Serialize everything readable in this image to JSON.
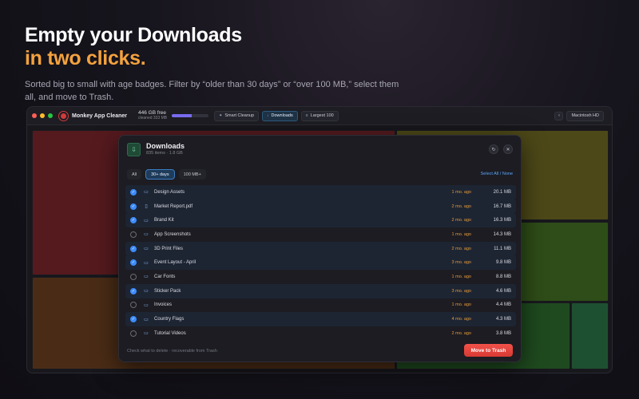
{
  "hero": {
    "title_line1": "Empty your Downloads",
    "title_line2": "in two clicks.",
    "subtitle": "Sorted big to small with age badges. Filter by “older than 30 days” or “over 100 MB,” select them all, and move to Trash."
  },
  "app": {
    "name": "Monkey App Cleaner",
    "disk_free": "446 GB free",
    "cleaned": "cleaned 333 MB",
    "disk_used_fraction": 0.55,
    "toolbar": [
      {
        "label": "Smart Cleanup",
        "icon": "sparkle-icon",
        "active": false
      },
      {
        "label": "Downloads",
        "icon": "download-icon",
        "active": true
      },
      {
        "label": "Largest 100",
        "icon": "list-icon",
        "active": false
      }
    ],
    "volume": "Macintosh HD"
  },
  "dialog": {
    "title": "Downloads",
    "meta": "835 items · 1.8 GB",
    "filters": [
      {
        "label": "All",
        "active": false
      },
      {
        "label": "30+ days",
        "active": true
      },
      {
        "label": "100 MB+",
        "active": false
      }
    ],
    "select_all": "Select All / None",
    "rows": [
      {
        "name": "Design Assets",
        "type": "folder",
        "age": "1 mo. ago",
        "size": "20.1 MB",
        "checked": true
      },
      {
        "name": "Market Report.pdf",
        "type": "file",
        "age": "2 mo. ago",
        "size": "16.7 MB",
        "checked": true
      },
      {
        "name": "Brand Kit",
        "type": "folder",
        "age": "2 mo. ago",
        "size": "16.3 MB",
        "checked": true
      },
      {
        "name": "App Screenshots",
        "type": "folder",
        "age": "1 mo. ago",
        "size": "14.3 MB",
        "checked": false
      },
      {
        "name": "3D Print Files",
        "type": "folder",
        "age": "2 mo. ago",
        "size": "11.1 MB",
        "checked": true
      },
      {
        "name": "Event Layout - April",
        "type": "folder",
        "age": "3 mo. ago",
        "size": "9.8 MB",
        "checked": true
      },
      {
        "name": "Car Fonts",
        "type": "folder",
        "age": "1 mo. ago",
        "size": "8.8 MB",
        "checked": false
      },
      {
        "name": "Sticker Pack",
        "type": "folder",
        "age": "3 mo. ago",
        "size": "4.6 MB",
        "checked": true
      },
      {
        "name": "Invoices",
        "type": "folder",
        "age": "1 mo. ago",
        "size": "4.4 MB",
        "checked": false
      },
      {
        "name": "Country Flags",
        "type": "folder",
        "age": "4 mo. ago",
        "size": "4.3 MB",
        "checked": true
      },
      {
        "name": "Tutorial Videos",
        "type": "folder",
        "age": "2 mo. ago",
        "size": "3.8 MB",
        "checked": false
      }
    ],
    "footer_hint": "Check what to delete · recoverable from Trash",
    "trash_button": "Move to Trash"
  },
  "colors": {
    "accent_orange": "#f4a23e",
    "check_blue": "#3d8cff",
    "trash_red": "#e5463f",
    "tile_red": "#5a1a1c",
    "tile_brown": "#4a2a18",
    "tile_olive": "#4a4a18",
    "tile_green": "#1f4a1f"
  }
}
